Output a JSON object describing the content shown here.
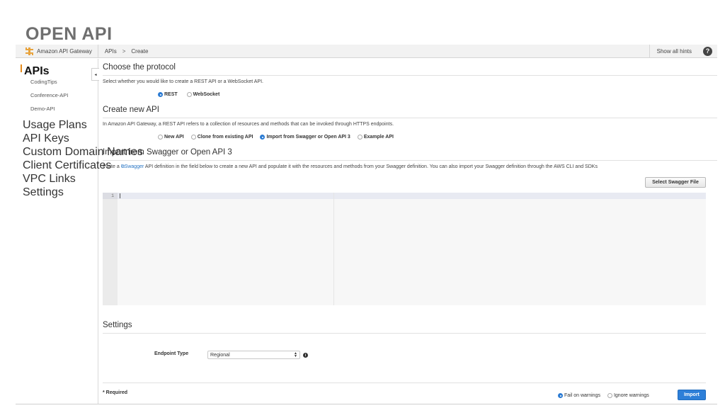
{
  "slide": {
    "title": "OPEN API"
  },
  "topbar": {
    "brand": "Amazon API Gateway",
    "breadcrumb": [
      "APIs",
      "Create"
    ],
    "breadcrumb_sep": ">",
    "show_hints": "Show all hints",
    "help": "?"
  },
  "sidebar": {
    "collapse_glyph": "◂",
    "items": [
      {
        "label": "APIs"
      },
      {
        "label": "CodingTips"
      },
      {
        "label": "Conference-API"
      },
      {
        "label": "Demo-API"
      },
      {
        "label": "Usage Plans"
      },
      {
        "label": "API Keys"
      },
      {
        "label": "Custom Domain Names"
      },
      {
        "label": "Client Certificates"
      },
      {
        "label": "VPC Links"
      },
      {
        "label": "Settings"
      }
    ]
  },
  "protocol": {
    "heading": "Choose the protocol",
    "description": "Select whether you would like to create a REST API or a WebSocket API.",
    "options": [
      {
        "label": "REST",
        "selected": true
      },
      {
        "label": "WebSocket",
        "selected": false
      }
    ]
  },
  "create": {
    "heading": "Create new API",
    "description": "In Amazon API Gateway, a REST API refers to a collection of resources and methods that can be invoked through HTTPS endpoints.",
    "options": [
      {
        "label": "New API",
        "selected": false
      },
      {
        "label": "Clone from existing API",
        "selected": false
      },
      {
        "label": "Import from Swagger or Open API 3",
        "selected": true
      },
      {
        "label": "Example API",
        "selected": false
      }
    ]
  },
  "import": {
    "heading": "Import from Swagger or Open API 3",
    "desc_prefix": "Paste a ",
    "desc_link": "Swagger",
    "desc_suffix": " API definition in the field below to create a new API and populate it with the resources and methods from your Swagger definition. You can also import your Swagger definition through the AWS CLI and SDKs",
    "select_file_button": "Select Swagger File",
    "editor": {
      "line_number": "1",
      "content": ""
    }
  },
  "settings": {
    "heading": "Settings",
    "endpoint_label": "Endpoint Type",
    "endpoint_value": "Regional",
    "info": "i"
  },
  "footer": {
    "required": "* Required",
    "warning_options": [
      {
        "label": "Fail on warnings",
        "selected": true
      },
      {
        "label": "Ignore warnings",
        "selected": false
      }
    ],
    "import_button": "Import"
  },
  "colors": {
    "accent": "#2d7fd8",
    "brand": "#e8a33d",
    "active_nav": "#e58b1c",
    "link": "#2a76c4"
  }
}
